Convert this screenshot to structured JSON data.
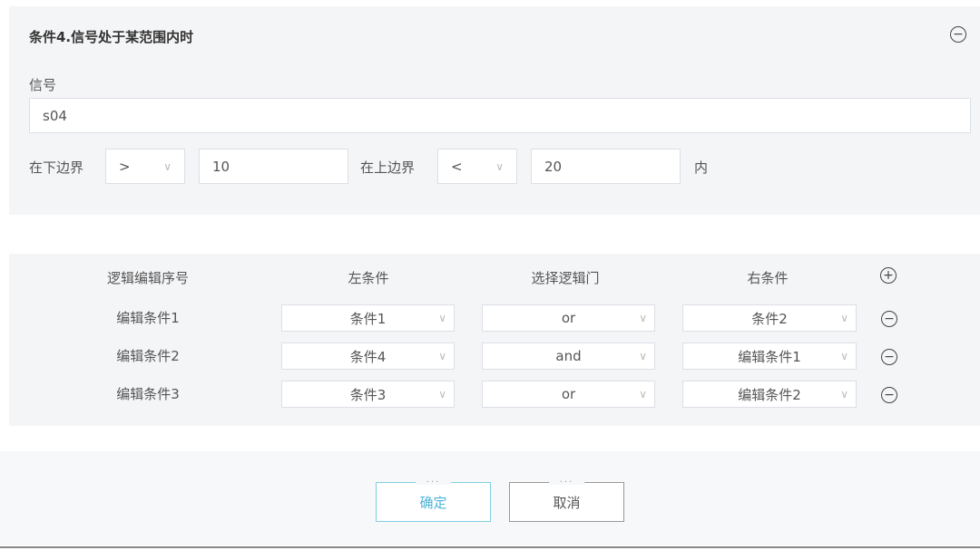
{
  "condition": {
    "title": "条件4.信号处于某范围内时",
    "signal_label": "信号",
    "signal_value": "s04",
    "lower_label": "在下边界",
    "lower_op": ">",
    "lower_value": "10",
    "upper_label": "在上边界",
    "upper_op": "<",
    "upper_value": "20",
    "suffix": "内"
  },
  "logic": {
    "headers": [
      "逻辑编辑序号",
      "左条件",
      "选择逻辑门",
      "右条件"
    ],
    "rows": [
      {
        "label": "编辑条件1",
        "left": "条件1",
        "gate": "or",
        "right": "条件2"
      },
      {
        "label": "编辑条件2",
        "left": "条件4",
        "gate": "and",
        "right": "编辑条件1"
      },
      {
        "label": "编辑条件3",
        "left": "条件3",
        "gate": "or",
        "right": "编辑条件2"
      }
    ]
  },
  "footer": {
    "ok": "确定",
    "cancel": "取消",
    "dots": "..."
  },
  "icons": {
    "minus": "−",
    "plus": "+",
    "chevron": "∨"
  }
}
